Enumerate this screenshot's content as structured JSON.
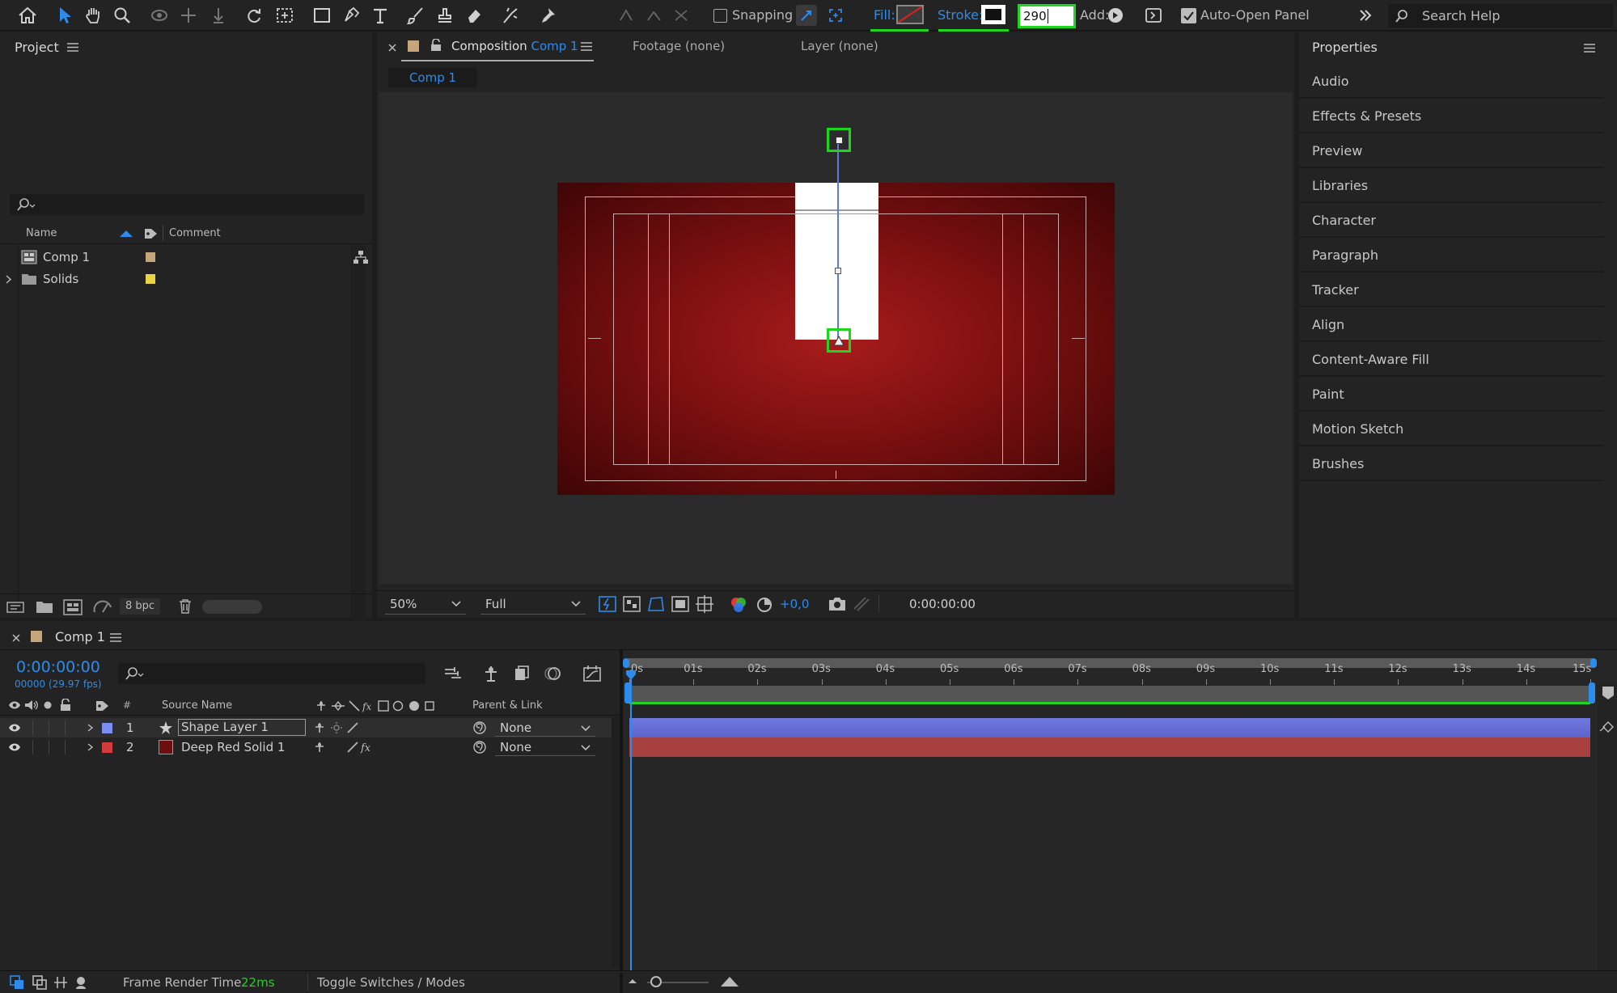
{
  "toolbar": {
    "snapping_label": "Snapping",
    "fill_label": "Fill:",
    "stroke_label": "Stroke:",
    "stroke_width_value": "290",
    "add_label": "Add:",
    "auto_open_label": "Auto-Open Panel",
    "search_placeholder": "Search Help"
  },
  "project": {
    "title": "Project",
    "columns": {
      "name": "Name",
      "comment": "Comment"
    },
    "items": [
      {
        "name": "Comp 1",
        "label_color": "#c6a57a"
      },
      {
        "name": "Solids",
        "label_color": "#e8d246"
      }
    ],
    "bpc": "8 bpc"
  },
  "viewer": {
    "tab_composition_prefix": "Composition",
    "tab_composition_name": "Comp 1",
    "tab_footage": "Footage (none)",
    "tab_layer": "Layer (none)",
    "breadcrumb": "Comp 1",
    "zoom": "50%",
    "resolution": "Full",
    "exposure": "+0,0",
    "timecode": "0:00:00:00"
  },
  "properties": {
    "title": "Properties",
    "items": [
      "Audio",
      "Effects & Presets",
      "Preview",
      "Libraries",
      "Character",
      "Paragraph",
      "Tracker",
      "Align",
      "Content-Aware Fill",
      "Paint",
      "Motion Sketch",
      "Brushes"
    ]
  },
  "timeline": {
    "comp_name": "Comp 1",
    "current_time": "0:00:00:00",
    "frame_info": "00000 (29.97 fps)",
    "col_source_name": "Source Name",
    "col_parent": "Parent & Link",
    "ruler": [
      "0s",
      "01s",
      "02s",
      "03s",
      "04s",
      "05s",
      "06s",
      "07s",
      "08s",
      "09s",
      "10s",
      "11s",
      "12s",
      "13s",
      "14s",
      "15s"
    ],
    "layers": [
      {
        "num": "1",
        "name": "Shape Layer 1",
        "parent": "None",
        "label_color": "#7b8ff0",
        "bar_color": "#6b73d8"
      },
      {
        "num": "2",
        "name": "Deep Red Solid 1",
        "parent": "None",
        "label_color": "#d23b3b",
        "bar_color": "#a8403f"
      }
    ]
  },
  "status": {
    "frame_render_label": "Frame Render Time",
    "frame_render_value": "22ms",
    "toggle_label": "Toggle Switches / Modes"
  },
  "colors": {
    "accent": "#2d8ceb",
    "highlight_green": "#1fd61f",
    "comp_red": "#8b1212"
  }
}
